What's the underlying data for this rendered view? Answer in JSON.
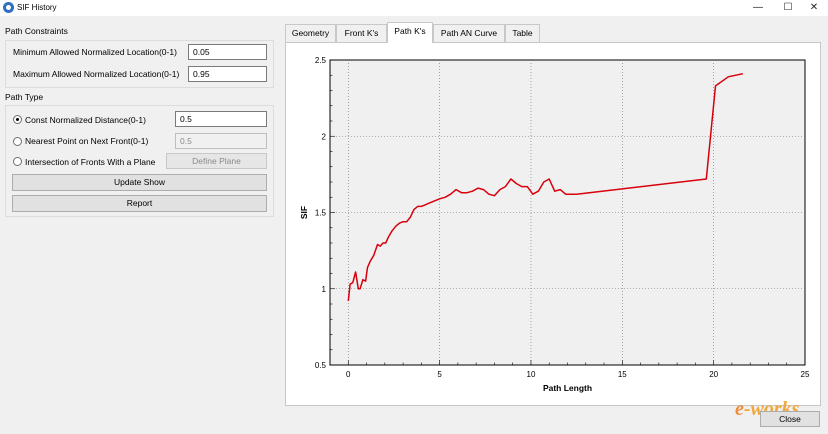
{
  "window": {
    "title": "SIF History",
    "controls": [
      "—",
      "☐",
      "✕"
    ]
  },
  "constraints": {
    "title": "Path Constraints",
    "min_label": "Minimum Allowed Normalized Location(0-1)",
    "min_value": "0.05",
    "max_label": "Maximum Allowed Normalized Location(0-1)",
    "max_value": "0.95"
  },
  "path_type": {
    "title": "Path Type",
    "opt1_label": "Const Normalized Distance(0-1)",
    "opt1_value": "0.5",
    "opt2_label": "Nearest Point on Next Front(0-1)",
    "opt2_value": "0.5",
    "opt3_label": "Intersection of Fronts With a Plane",
    "define_plane": "Define Plane",
    "selected": "Const Normalized Distance(0-1)"
  },
  "buttons": {
    "update_show": "Update Show",
    "report": "Report",
    "close": "Close"
  },
  "tabs": [
    "Geometry",
    "Front K's",
    "Path K's",
    "Path AN Curve",
    "Table"
  ],
  "active_tab": "Path K's",
  "watermark": {
    "e": "e",
    "rest": "-works"
  },
  "colors": {
    "line": "#d8000c",
    "grid": "#707070",
    "plot_bg": "#f0f0f0"
  },
  "chart_data": {
    "type": "line",
    "xlabel": "Path Length",
    "ylabel": "SIF",
    "xlim": [
      -1,
      25
    ],
    "ylim": [
      0.5,
      2.5
    ],
    "x_ticks": [
      0,
      5,
      10,
      15,
      20,
      25
    ],
    "y_ticks": [
      0.5,
      1,
      1.5,
      2,
      2.5
    ],
    "x_tick_labels": [
      "0",
      "5",
      "10",
      "15",
      "20",
      "25"
    ],
    "y_tick_labels": [
      "0.5",
      "1",
      "1.5",
      "2",
      "2.5"
    ],
    "grid": "dotted at major ticks",
    "series": [
      {
        "x": [
          0,
          0.1,
          0.25,
          0.4,
          0.55,
          0.65,
          0.8,
          0.95,
          1.05,
          1.2,
          1.4,
          1.6,
          1.75,
          1.9,
          2.05,
          2.2,
          2.4,
          2.6,
          2.8,
          3.0,
          3.2,
          3.4,
          3.6,
          3.8,
          4.0,
          4.2,
          4.4,
          4.6,
          4.8,
          5.0,
          5.3,
          5.6,
          5.9,
          6.2,
          6.5,
          6.8,
          7.1,
          7.4,
          7.7,
          8.0,
          8.3,
          8.6,
          8.9,
          9.2,
          9.5,
          9.8,
          10.1,
          10.4,
          10.7,
          11.0,
          11.3,
          11.6,
          11.9,
          12.2,
          12.5,
          19.6,
          20.1,
          20.8,
          21.6
        ],
        "y": [
          0.92,
          1.03,
          1.04,
          1.11,
          1.0,
          1.0,
          1.06,
          1.05,
          1.14,
          1.18,
          1.22,
          1.29,
          1.28,
          1.3,
          1.3,
          1.34,
          1.38,
          1.41,
          1.43,
          1.44,
          1.44,
          1.47,
          1.52,
          1.54,
          1.54,
          1.55,
          1.56,
          1.57,
          1.58,
          1.59,
          1.6,
          1.62,
          1.65,
          1.63,
          1.63,
          1.64,
          1.66,
          1.65,
          1.62,
          1.61,
          1.65,
          1.67,
          1.72,
          1.69,
          1.67,
          1.67,
          1.62,
          1.64,
          1.7,
          1.72,
          1.64,
          1.65,
          1.62,
          1.62,
          1.62,
          1.72,
          2.33,
          2.39,
          2.41
        ]
      }
    ]
  }
}
